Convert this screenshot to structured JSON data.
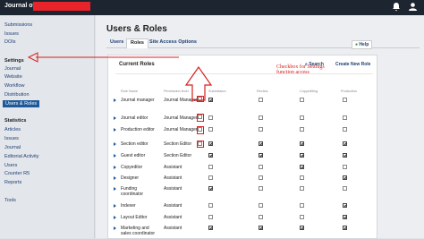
{
  "topbar": {
    "journal_label": "Journal of"
  },
  "sidebar": {
    "items": [
      "Submissions",
      "Issues",
      "DOIs"
    ],
    "settings_header": "Settings",
    "settings_items": [
      "Journal",
      "Website",
      "Workflow",
      "Distribution",
      "Users & Roles"
    ],
    "statistics_header": "Statistics",
    "statistics_items": [
      "Articles",
      "Issues",
      "Journal",
      "Editorial Activity",
      "Users",
      "Counter R5",
      "Reports"
    ],
    "tools": "Tools"
  },
  "main": {
    "title": "Users & Roles",
    "tabs": [
      "Users",
      "Roles",
      "Site Access Options"
    ],
    "help": "Help"
  },
  "panel": {
    "title": "Current Roles",
    "search_label": "Search",
    "create_label": "Create New Role",
    "columns": [
      "Role Name",
      "Permission level",
      "Submission",
      "Review",
      "Copyediting",
      "Production"
    ],
    "rows": [
      {
        "name": "Journal manager",
        "level": "Journal Manager",
        "checks": [
          true,
          false,
          false,
          false
        ]
      },
      {
        "name": "Journal editor",
        "level": "Journal Manager",
        "checks": [
          false,
          false,
          false,
          false
        ]
      },
      {
        "name": "Production editor",
        "level": "Journal Manager",
        "checks": [
          false,
          false,
          false,
          false
        ]
      },
      {
        "name": "Section editor",
        "level": "Section Editor",
        "checks": [
          true,
          true,
          true,
          true
        ]
      },
      {
        "name": "Guest editor",
        "level": "Section Editor",
        "checks": [
          true,
          true,
          true,
          true
        ]
      },
      {
        "name": "Copyeditor",
        "level": "Assistant",
        "checks": [
          false,
          false,
          true,
          false
        ]
      },
      {
        "name": "Designer",
        "level": "Assistant",
        "checks": [
          false,
          false,
          false,
          true
        ]
      },
      {
        "name": "Funding coordinator",
        "level": "Assistant",
        "checks": [
          true,
          false,
          false,
          false
        ]
      },
      {
        "name": "Indexer",
        "level": "Assistant",
        "checks": [
          false,
          false,
          false,
          true
        ]
      },
      {
        "name": "Layout Editor",
        "level": "Assistant",
        "checks": [
          false,
          false,
          false,
          true
        ]
      },
      {
        "name": "Marketing and sales coordinator",
        "level": "Assistant",
        "checks": [
          true,
          true,
          true,
          true
        ]
      }
    ]
  },
  "annotation": {
    "text": "Checkbox for Settings function access",
    "color": "#d6201e"
  }
}
